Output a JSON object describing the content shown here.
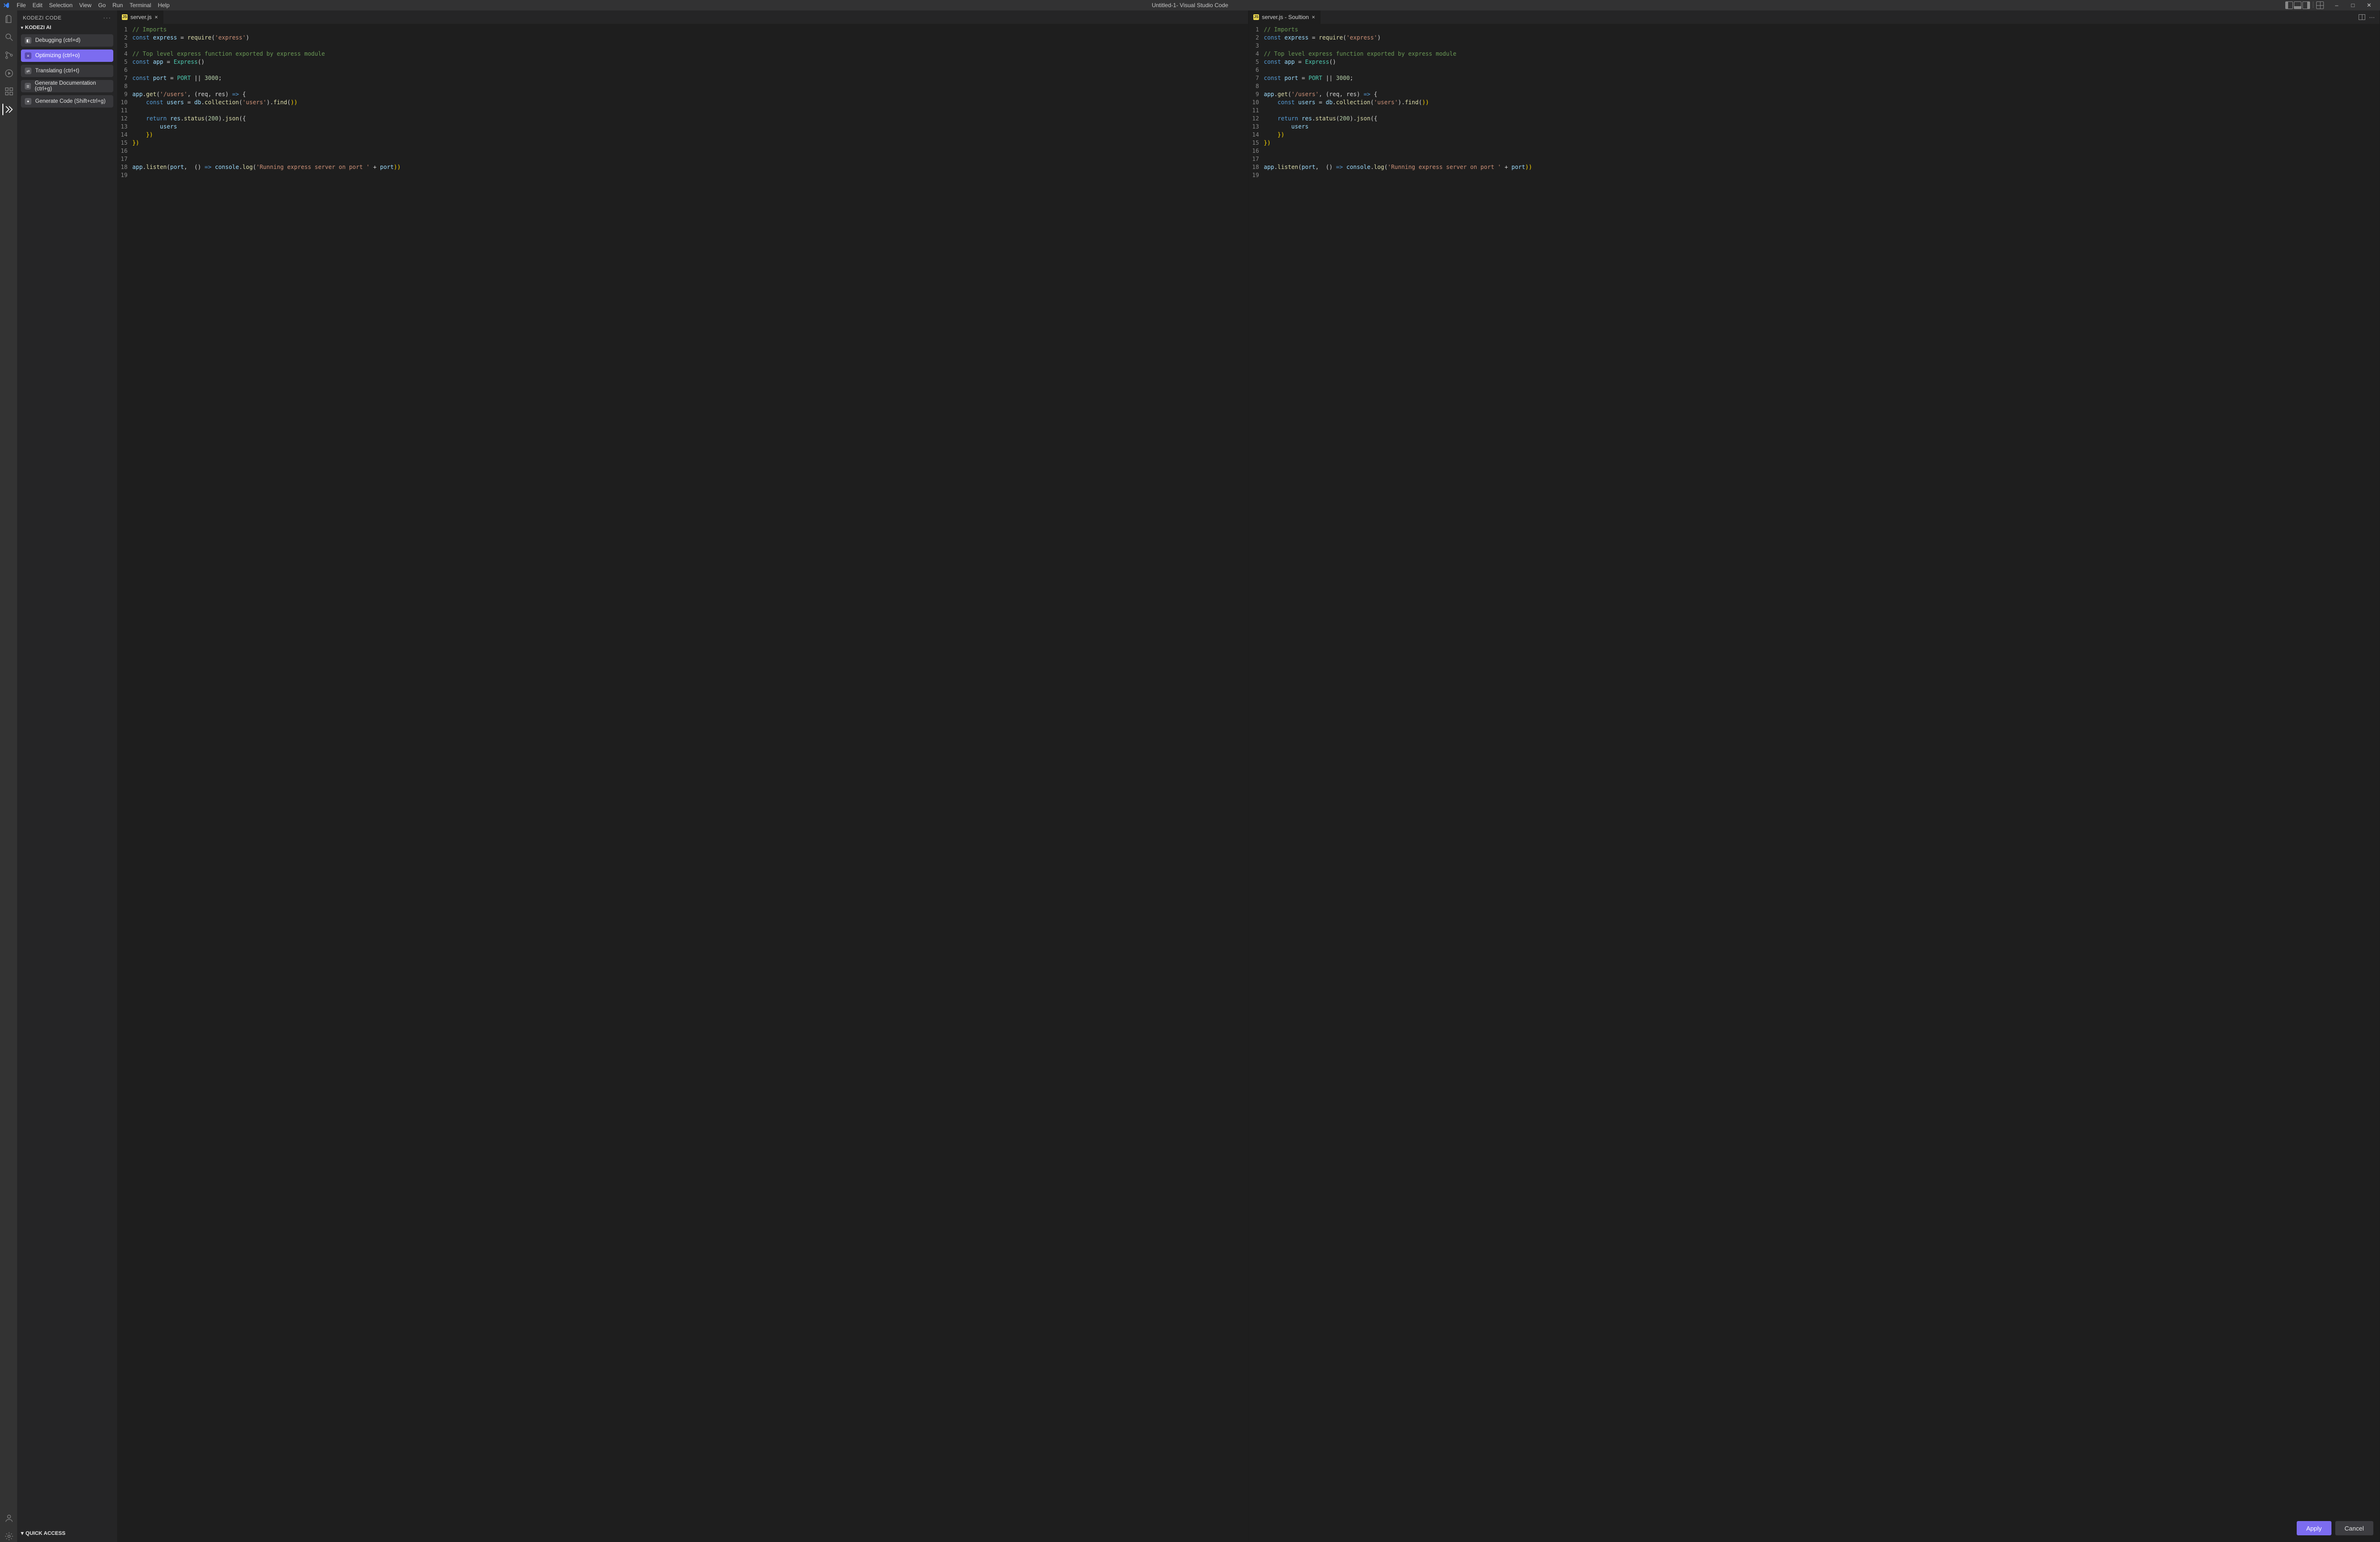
{
  "app": {
    "title": "Untitled-1- Visual Studio Code"
  },
  "menubar": [
    "File",
    "Edit",
    "Selection",
    "View",
    "Go",
    "Run",
    "Terminal",
    "Help"
  ],
  "sidebar": {
    "title": "KODEZI CODE",
    "section": "KODEZI AI",
    "quick_access": "QUICK ACCESS",
    "items": [
      {
        "label": "Debugging (ctrl+d)",
        "active": false
      },
      {
        "label": "Optimizing (ctrl+o)",
        "active": true
      },
      {
        "label": "Translating (ctrl+t)",
        "active": false
      },
      {
        "label": "Generate Documentation (ctrl+g)",
        "active": false
      },
      {
        "label": "Generate Code (Shift+ctrl+g)",
        "active": false
      }
    ]
  },
  "editors": {
    "left": {
      "tab_label": "server.js"
    },
    "right": {
      "tab_label": "server.js -  Soultion"
    }
  },
  "buttons": {
    "apply": "Apply",
    "cancel": "Cancel"
  },
  "code": {
    "line_count": 19,
    "lines": {
      "1": {
        "kind": "comment",
        "text": "// Imports"
      },
      "2": {
        "kind": "const_require",
        "name": "express",
        "module": "express"
      },
      "3": {
        "kind": "blank"
      },
      "4": {
        "kind": "comment",
        "text": "// Top level express function exported by express module"
      },
      "5": {
        "kind": "const_call",
        "name": "app",
        "callee": "Express",
        "args": ""
      },
      "6": {
        "kind": "blank"
      },
      "7": {
        "kind": "const_expr",
        "name": "port",
        "rhs_a": "PORT",
        "rhs_op": " || ",
        "rhs_b": "3000",
        "semi": ";"
      },
      "8": {
        "kind": "blank"
      },
      "9": {
        "kind": "app_get",
        "route": "/users",
        "params": "(req, res)"
      },
      "10": {
        "kind": "const_find",
        "indent": "    ",
        "name": "users",
        "collection": "users"
      },
      "11": {
        "kind": "blank"
      },
      "12": {
        "kind": "return_json",
        "indent": "    ",
        "status": "200"
      },
      "13": {
        "kind": "raw",
        "indent": "        ",
        "text": "users"
      },
      "14": {
        "kind": "close_obj",
        "indent": "    ",
        "text": "})"
      },
      "15": {
        "kind": "close_obj",
        "indent": "",
        "text": "})"
      },
      "16": {
        "kind": "blank"
      },
      "17": {
        "kind": "blank"
      },
      "18": {
        "kind": "listen",
        "msg": "Running express server on port "
      },
      "19": {
        "kind": "blank"
      }
    }
  }
}
